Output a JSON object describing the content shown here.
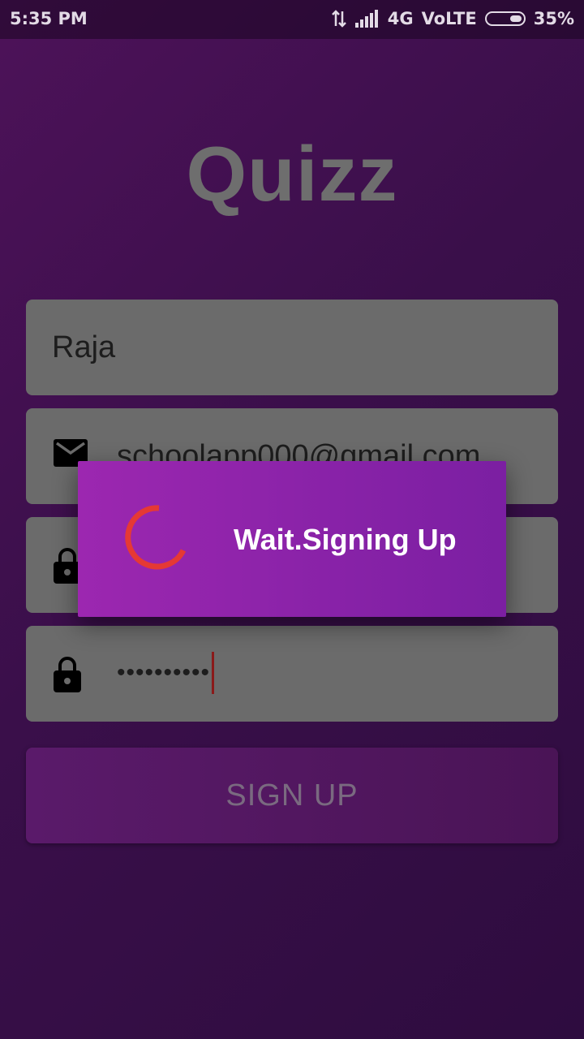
{
  "status_bar": {
    "time": "5:35 PM",
    "network": "4G",
    "volte": "VoLTE",
    "battery": "35%"
  },
  "app": {
    "title": "Quizz"
  },
  "form": {
    "name_value": "Raja",
    "email_value": "schoolapp000@gmail.com",
    "password_value": "••••••••••",
    "confirm_password_value": "••••••••••",
    "signup_label": "SIGN UP"
  },
  "dialog": {
    "message": "Wait.Signing Up"
  },
  "icons": {
    "email": "email-icon",
    "lock": "lock-icon",
    "spinner": "loading-spinner-icon",
    "data_transfer": "data-transfer-icon",
    "signal": "signal-icon",
    "battery": "battery-icon"
  },
  "colors": {
    "dialog_bg": "#9c27b0",
    "spinner": "#e53935",
    "field_bg": "#6b6b6b",
    "background": "#3a0f4a"
  }
}
